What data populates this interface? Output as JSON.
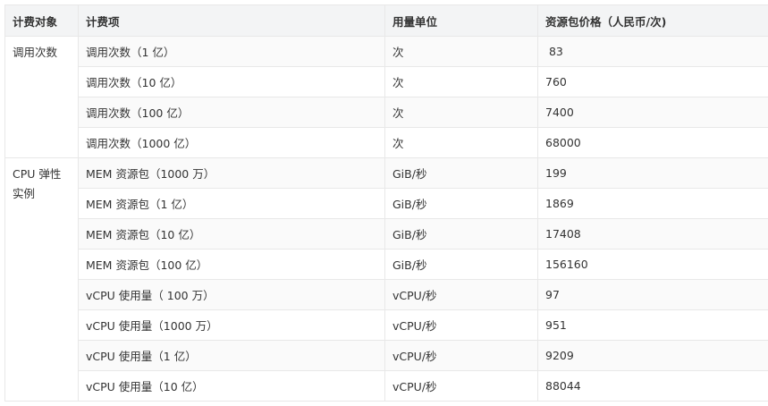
{
  "table": {
    "headers": [
      "计费对象",
      "计费项",
      "用量单位",
      "资源包价格（人民币/次)"
    ],
    "groups": [
      {
        "object": "调用次数",
        "rows": [
          {
            "item": "调用次数（1 亿）",
            "unit": "次",
            "price": " 83"
          },
          {
            "item": "调用次数（10 亿）",
            "unit": "次",
            "price": "760"
          },
          {
            "item": "调用次数（100 亿）",
            "unit": "次",
            "price": "7400"
          },
          {
            "item": "调用次数（1000 亿）",
            "unit": "次",
            "price": "68000"
          }
        ]
      },
      {
        "object": "CPU 弹性实例",
        "object_lines": [
          "CPU 弹性",
          "实例"
        ],
        "rows": [
          {
            "item": "MEM 资源包（1000 万）",
            "unit": "GiB/秒",
            "price": "199"
          },
          {
            "item": "MEM 资源包（1 亿）",
            "unit": "GiB/秒",
            "price": "1869"
          },
          {
            "item": "MEM 资源包（10 亿）",
            "unit": "GiB/秒",
            "price": "17408"
          },
          {
            "item": "MEM 资源包（100 亿）",
            "unit": "GiB/秒",
            "price": "156160"
          },
          {
            "item": "vCPU 使用量（ 100 万）",
            "unit": "vCPU/秒",
            "price": "97"
          },
          {
            "item": "vCPU 使用量（1000 万）",
            "unit": "vCPU/秒",
            "price": "951"
          },
          {
            "item": "vCPU 使用量（1 亿）",
            "unit": "vCPU/秒",
            "price": "9209"
          },
          {
            "item": "vCPU 使用量（10 亿）",
            "unit": "vCPU/秒",
            "price": "88044"
          }
        ]
      }
    ]
  }
}
